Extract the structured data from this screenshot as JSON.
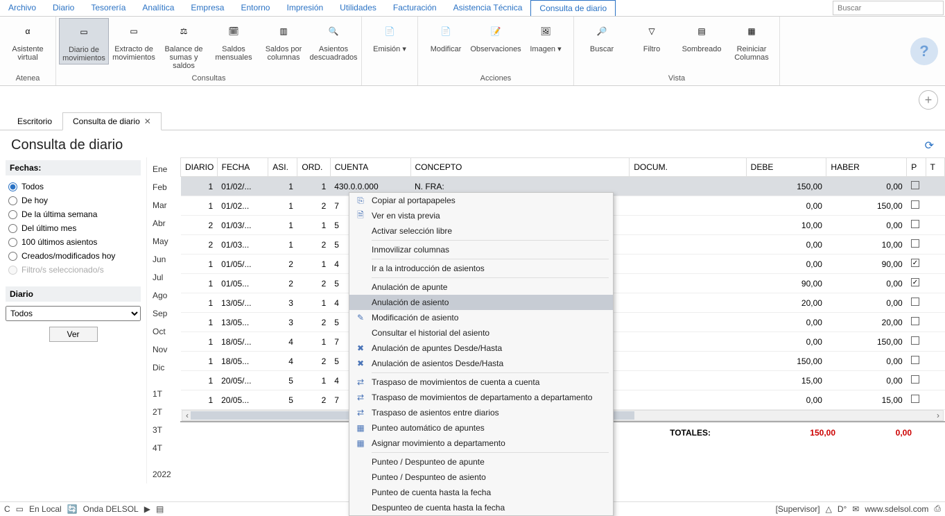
{
  "menubar": [
    "Archivo",
    "Diario",
    "Tesorería",
    "Analítica",
    "Empresa",
    "Entorno",
    "Impresión",
    "Utilidades",
    "Facturación",
    "Asistencia Técnica",
    "Consulta de diario"
  ],
  "menubar_active": 10,
  "search_placeholder": "Buscar",
  "ribbon": {
    "groups": [
      {
        "label": "Atenea",
        "items": [
          {
            "label": "Asistente virtual",
            "icon": "α"
          }
        ]
      },
      {
        "label": "Consultas",
        "items": [
          {
            "label": "Diario de movimientos",
            "icon": "▭",
            "active": true
          },
          {
            "label": "Extracto de movimientos",
            "icon": "▭"
          },
          {
            "label": "Balance de sumas y saldos",
            "icon": "⚖"
          },
          {
            "label": "Saldos mensuales",
            "icon": "🗓"
          },
          {
            "label": "Saldos por columnas",
            "icon": "▥"
          },
          {
            "label": "Asientos descuadrados",
            "icon": "🔍"
          }
        ]
      },
      {
        "label": "",
        "items": [
          {
            "label": "Emisión",
            "icon": "📄",
            "dropdown": true
          }
        ]
      },
      {
        "label": "Acciones",
        "items": [
          {
            "label": "Modificar",
            "icon": "📄"
          },
          {
            "label": "Observaciones",
            "icon": "📝"
          },
          {
            "label": "Imagen",
            "icon": "🖼",
            "dropdown": true
          }
        ]
      },
      {
        "label": "Vista",
        "items": [
          {
            "label": "Buscar",
            "icon": "🔎"
          },
          {
            "label": "Filtro",
            "icon": "▽"
          },
          {
            "label": "Sombreado",
            "icon": "▤"
          },
          {
            "label": "Reiniciar Columnas",
            "icon": "▦"
          }
        ]
      }
    ]
  },
  "doc_tabs": [
    {
      "label": "Escritorio",
      "open": false
    },
    {
      "label": "Consulta de diario",
      "open": true,
      "close": true
    }
  ],
  "page_title": "Consulta de diario",
  "fechas": {
    "head": "Fechas:",
    "options": [
      "Todos",
      "De hoy",
      "De la última semana",
      "Del último mes",
      "100 últimos asientos",
      "Creados/modificados hoy",
      "Filtro/s seleccionado/s"
    ],
    "selected": 0,
    "disabled": [
      6
    ]
  },
  "diario": {
    "head": "Diario",
    "option": "Todos",
    "ver": "Ver"
  },
  "months": [
    "Ene",
    "Feb",
    "Mar",
    "Abr",
    "May",
    "Jun",
    "Jul",
    "Ago",
    "Sep",
    "Oct",
    "Nov",
    "Dic",
    "",
    "1T",
    "2T",
    "3T",
    "4T",
    "",
    "2022"
  ],
  "grid": {
    "cols": [
      "DIARIO",
      "FECHA",
      "ASI.",
      "ORD.",
      "CUENTA",
      "CONCEPTO",
      "DOCUM.",
      "DEBE",
      "HABER",
      "P",
      "T"
    ],
    "rows": [
      {
        "sel": true,
        "diario": "1",
        "fecha": "01/02/...",
        "asi": "1",
        "ord": "1",
        "cuenta": "430.0.0.000",
        "concepto": "N. FRA:",
        "debe": "150,00",
        "haber": "0,00",
        "p": false
      },
      {
        "diario": "1",
        "fecha": "01/02...",
        "asi": "1",
        "ord": "2",
        "cuenta": "7",
        "debe": "0,00",
        "haber": "150,00",
        "p": false
      },
      {
        "diario": "2",
        "fecha": "01/03/...",
        "asi": "1",
        "ord": "1",
        "cuenta": "5",
        "debe": "10,00",
        "haber": "0,00",
        "p": false
      },
      {
        "diario": "2",
        "fecha": "01/03...",
        "asi": "1",
        "ord": "2",
        "cuenta": "5",
        "debe": "0,00",
        "haber": "10,00",
        "p": false
      },
      {
        "diario": "1",
        "fecha": "01/05/...",
        "asi": "2",
        "ord": "1",
        "cuenta": "4",
        "debe": "0,00",
        "haber": "90,00",
        "p": true
      },
      {
        "diario": "1",
        "fecha": "01/05...",
        "asi": "2",
        "ord": "2",
        "cuenta": "5",
        "debe": "90,00",
        "haber": "0,00",
        "p": true
      },
      {
        "diario": "1",
        "fecha": "13/05/...",
        "asi": "3",
        "ord": "1",
        "cuenta": "4",
        "debe": "20,00",
        "haber": "0,00",
        "p": false
      },
      {
        "diario": "1",
        "fecha": "13/05...",
        "asi": "3",
        "ord": "2",
        "cuenta": "5",
        "debe": "0,00",
        "haber": "20,00",
        "p": false
      },
      {
        "diario": "1",
        "fecha": "18/05/...",
        "asi": "4",
        "ord": "1",
        "cuenta": "7",
        "debe": "0,00",
        "haber": "150,00",
        "p": false
      },
      {
        "diario": "1",
        "fecha": "18/05...",
        "asi": "4",
        "ord": "2",
        "cuenta": "5",
        "debe": "150,00",
        "haber": "0,00",
        "p": false
      },
      {
        "diario": "1",
        "fecha": "20/05/...",
        "asi": "5",
        "ord": "1",
        "cuenta": "4",
        "debe": "15,00",
        "haber": "0,00",
        "p": false
      },
      {
        "diario": "1",
        "fecha": "20/05...",
        "asi": "5",
        "ord": "2",
        "cuenta": "7",
        "debe": "0,00",
        "haber": "15,00",
        "p": false
      }
    ],
    "totals": {
      "label": "TOTALES:",
      "debe": "150,00",
      "haber": "0,00"
    }
  },
  "ctxmenu": [
    {
      "icon": "⎘",
      "label": "Copiar al portapapeles"
    },
    {
      "icon": "🗎",
      "label": "Ver en vista previa"
    },
    {
      "label": "Activar selección libre"
    },
    {
      "sep": true
    },
    {
      "label": "Inmovilizar columnas"
    },
    {
      "sep": true
    },
    {
      "label": "Ir a la introducción de asientos"
    },
    {
      "sep": true
    },
    {
      "label": "Anulación de apunte"
    },
    {
      "label": "Anulación de asiento",
      "hov": true
    },
    {
      "icon": "✎",
      "label": "Modificación de asiento"
    },
    {
      "label": "Consultar el historial del asiento"
    },
    {
      "icon": "✖",
      "label": "Anulación de apuntes Desde/Hasta"
    },
    {
      "icon": "✖",
      "label": "Anulación de asientos Desde/Hasta"
    },
    {
      "sep": true
    },
    {
      "icon": "⇄",
      "label": "Traspaso de movimientos de cuenta a cuenta"
    },
    {
      "icon": "⇄",
      "label": "Traspaso de movimientos de departamento a departamento"
    },
    {
      "icon": "⇄",
      "label": "Traspaso de asientos entre diarios"
    },
    {
      "icon": "▦",
      "label": "Punteo automático de apuntes"
    },
    {
      "icon": "▦",
      "label": "Asignar movimiento a departamento"
    },
    {
      "sep": true
    },
    {
      "label": "Punteo / Despunteo de apunte"
    },
    {
      "label": "Punteo / Despunteo de asiento"
    },
    {
      "label": "Punteo de cuenta hasta la fecha"
    },
    {
      "label": "Despunteo de cuenta hasta la fecha"
    }
  ],
  "status": {
    "left": [
      "C",
      "▭",
      "En Local",
      "🔄",
      "Onda DELSOL",
      "▶",
      "▤"
    ],
    "right": [
      "[Supervisor]",
      "△",
      "D°",
      "✉",
      "www.sdelsol.com",
      "⎙"
    ]
  }
}
